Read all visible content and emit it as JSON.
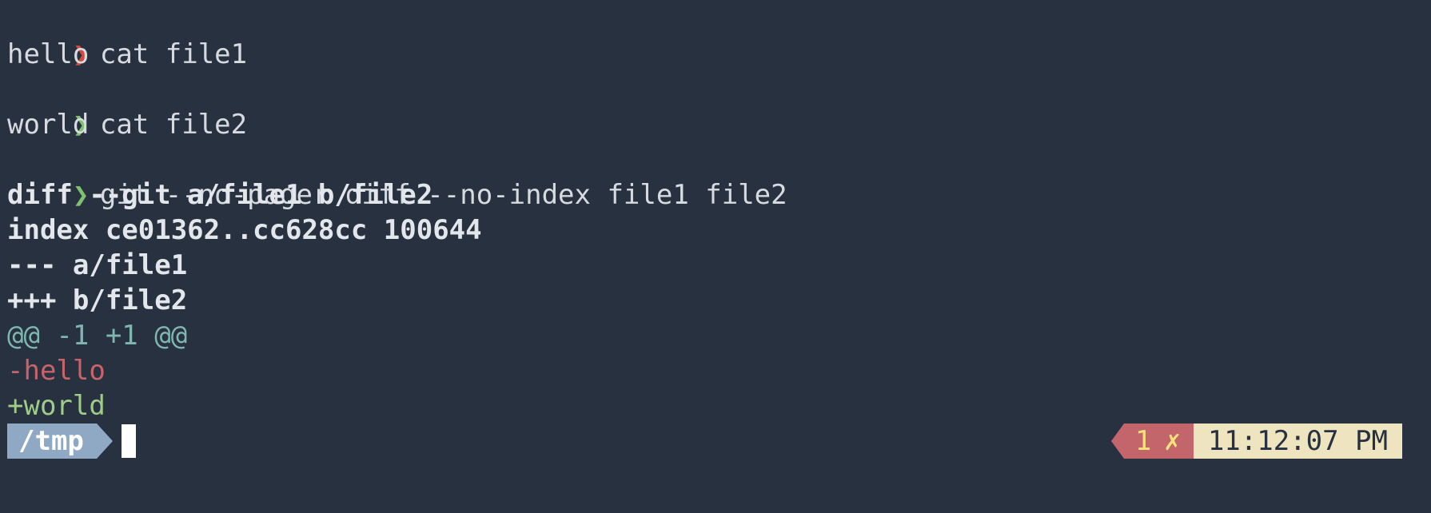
{
  "terminal": {
    "lines": [
      {
        "kind": "prompt",
        "caret": "❯",
        "caret_color": "#d8493c",
        "text": "cat file1"
      },
      {
        "kind": "output",
        "text": "hello"
      },
      {
        "kind": "prompt",
        "caret": "❯",
        "caret_color": "#7ec16e",
        "text": "cat file2"
      },
      {
        "kind": "output",
        "text": "world"
      },
      {
        "kind": "prompt",
        "caret": "❯",
        "caret_color": "#7ec16e",
        "text": "git --no-pager diff --no-index file1 file2"
      },
      {
        "kind": "diff-header",
        "text": "diff --git a/file1 b/file2"
      },
      {
        "kind": "diff-header",
        "text": "index ce01362..cc628cc 100644"
      },
      {
        "kind": "diff-header",
        "text": "--- a/file1"
      },
      {
        "kind": "diff-header",
        "text": "+++ b/file2"
      },
      {
        "kind": "hunk",
        "text": "@@ -1 +1 @@"
      },
      {
        "kind": "del",
        "text": "-hello"
      },
      {
        "kind": "add",
        "text": "+world"
      }
    ]
  },
  "prompt": {
    "directory": "/tmp"
  },
  "status": {
    "exit_code": "1",
    "error_mark": "✗",
    "time": "11:12:07 PM"
  },
  "colors": {
    "background": "#283140",
    "dir_segment": "#8fa8c4",
    "error_segment": "#c3666c",
    "time_segment": "#efe4c0"
  }
}
